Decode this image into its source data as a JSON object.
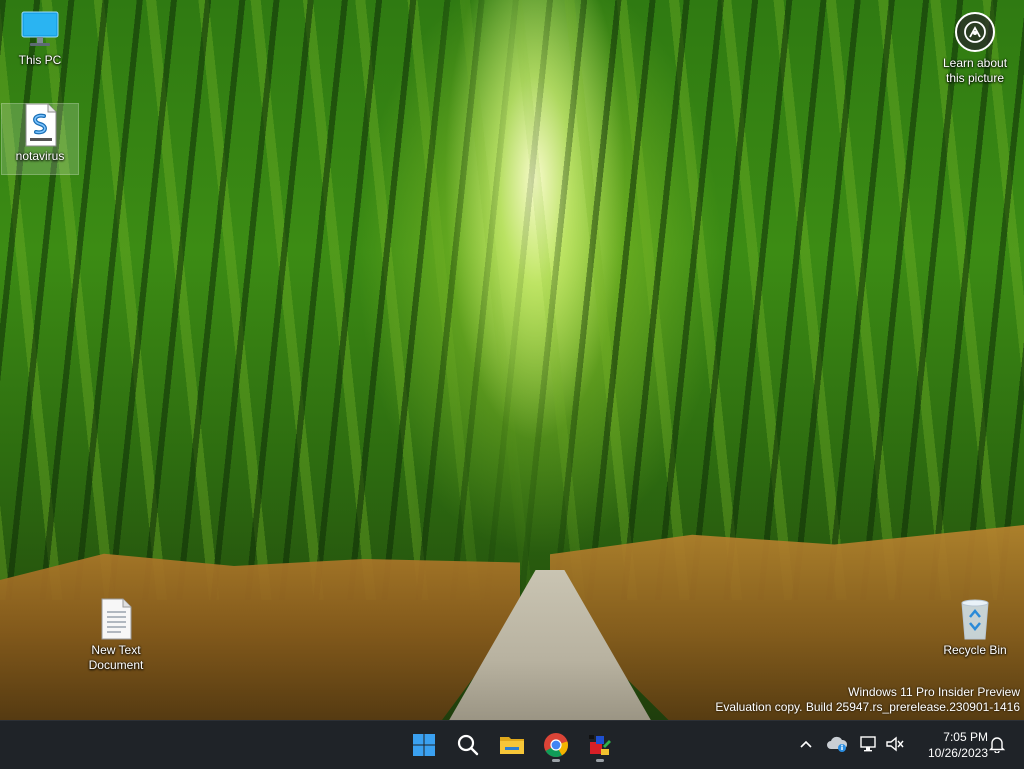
{
  "desktop": {
    "icons": [
      {
        "label": "This PC",
        "icon": "monitor-icon"
      },
      {
        "label": "notavirus",
        "icon": "script-file-icon"
      },
      {
        "label": "New Text Document",
        "icon": "text-document-icon"
      },
      {
        "label": "Recycle Bin",
        "icon": "recycle-bin-icon"
      }
    ],
    "learn_about": {
      "line1": "Learn about",
      "line2": "this picture",
      "icon": "camera-circle-icon"
    },
    "watermark": {
      "line1": "Windows 11 Pro Insider Preview",
      "line2": "Evaluation copy. Build 25947.rs_prerelease.230901-1416"
    }
  },
  "taskbar": {
    "apps": [
      {
        "name": "Start",
        "icon": "windows-logo-icon"
      },
      {
        "name": "Search",
        "icon": "search-icon"
      },
      {
        "name": "File Explorer",
        "icon": "folder-icon"
      },
      {
        "name": "Google Chrome",
        "icon": "chrome-icon"
      },
      {
        "name": "Paint app",
        "icon": "paint-app-icon"
      }
    ],
    "tray": {
      "overflow_icon": "chevron-up-icon",
      "icons": [
        "onedrive-cloud-icon",
        "network-icon",
        "volume-muted-icon",
        "notification-bell-icon"
      ]
    },
    "clock": {
      "time": "7:05 PM",
      "date": "10/26/2023"
    }
  },
  "colors": {
    "taskbar_bg": "#1f2328",
    "windows_blue": "#1d9bf0",
    "folder_yellow": "#f2c12e"
  }
}
